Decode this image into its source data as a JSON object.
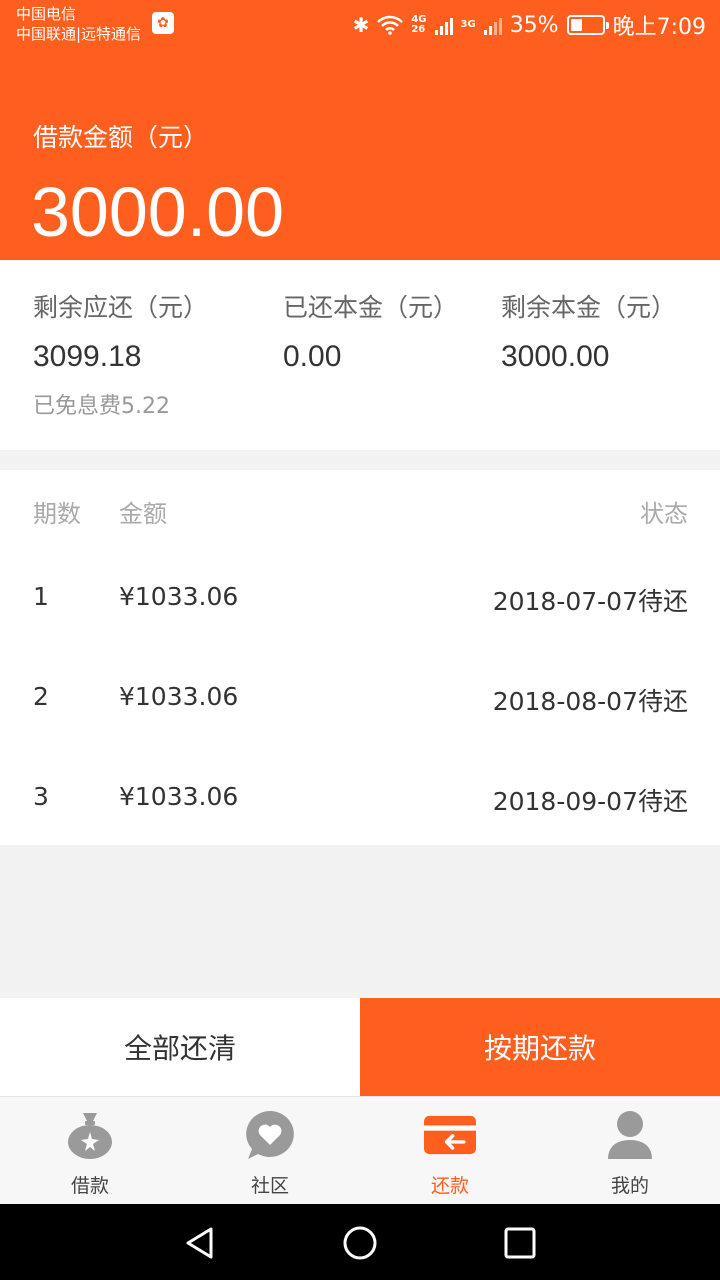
{
  "status_bar": {
    "carrier1": "中国电信",
    "carrier2": "中国联通|远特通信",
    "battery": "35%",
    "time": "晚上7:09",
    "net1": "4G",
    "net2": "26",
    "net3": "3G"
  },
  "header": {
    "loan_label": "借款金额（元）",
    "loan_amount": "3000.00",
    "bg_color": "#ff5f1e"
  },
  "summary": {
    "remaining_due_label": "剩余应还（元）",
    "remaining_due_value": "3099.18",
    "repaid_principal_label": "已还本金（元）",
    "repaid_principal_value": "0.00",
    "remaining_principal_label": "剩余本金（元）",
    "remaining_principal_value": "3000.00",
    "waived_note": "已免息费5.22"
  },
  "schedule": {
    "headers": {
      "period": "期数",
      "amount": "金额",
      "status": "状态"
    },
    "rows": [
      {
        "period": "1",
        "amount": "¥1033.06",
        "status": "2018-07-07待还"
      },
      {
        "period": "2",
        "amount": "¥1033.06",
        "status": "2018-08-07待还"
      },
      {
        "period": "3",
        "amount": "¥1033.06",
        "status": "2018-09-07待还"
      }
    ]
  },
  "actions": {
    "pay_all": "全部还清",
    "pay_by_period": "按期还款"
  },
  "tabs": [
    {
      "label": "借款",
      "icon": "money-bag-icon",
      "active": false
    },
    {
      "label": "社区",
      "icon": "heart-bubble-icon",
      "active": false
    },
    {
      "label": "还款",
      "icon": "card-return-icon",
      "active": true
    },
    {
      "label": "我的",
      "icon": "user-icon",
      "active": false
    }
  ],
  "colors": {
    "accent": "#ff5f1e",
    "inactive_icon": "#9a9a9a"
  }
}
